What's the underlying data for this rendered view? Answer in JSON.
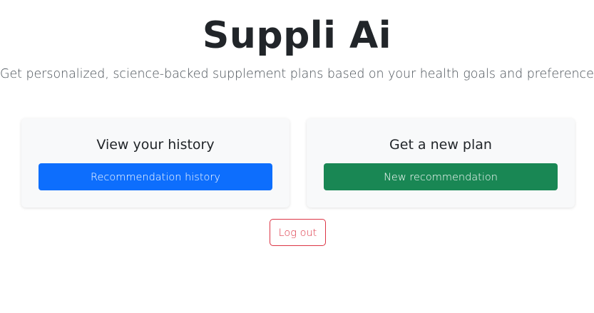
{
  "header": {
    "title": "Suppli Ai",
    "subtitle": "Get personalized, science-backed supplement plans based on your health goals and preferences."
  },
  "cards": [
    {
      "title": "View your history",
      "button_label": "Recommendation history",
      "button_color": "#0d6efd"
    },
    {
      "title": "Get a new plan",
      "button_label": "New recommendation",
      "button_color": "#198754"
    }
  ],
  "logout": {
    "label": "Log out",
    "color": "#dc3545"
  }
}
